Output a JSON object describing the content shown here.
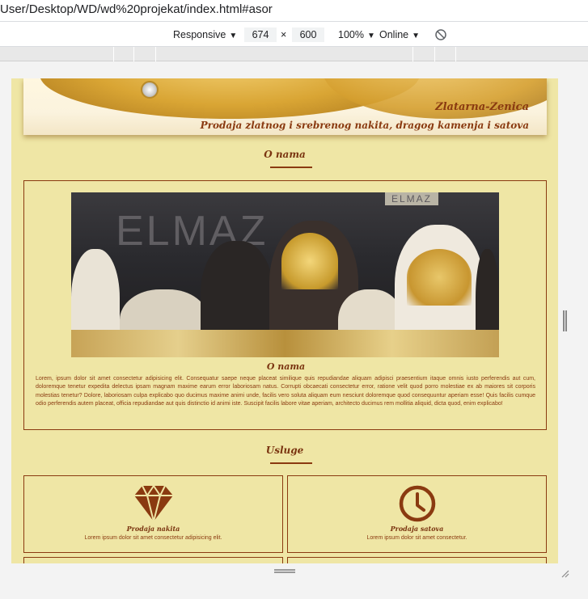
{
  "browser": {
    "url": "User/Desktop/WD/wd%20projekat/index.html#asor"
  },
  "devtools": {
    "device": "Responsive",
    "width": "674",
    "times": "×",
    "height": "600",
    "zoom": "100%",
    "throttle": "Online"
  },
  "hero": {
    "brand": "Zlatarna-Zenica",
    "tagline": "Prodaja zlatnog i srebrenog nakita, dragog kamenja i satova"
  },
  "about": {
    "heading": "O nama",
    "subheading": "O nama",
    "text": "Lorem, ipsum dolor sit amet consectetur adipisicing elit. Consequatur saepe neque placeat similique quis repudiandae aliquam adipisci praesentium itaque omnis iusto perferendis aut cum, doloremque tenetur expedita delectus ipsam magnam maxime earum error laboriosam natus. Corrupti obcaecati consectetur error, ratione velit quod porro molestiae ex ab maiores sit corporis molestias tenetur? Dolore, laboriosam culpa explicabo quo ducimus maxime animi unde, facilis vero soluta aliquam eum nesciunt doloremque quod consequuntur aperiam esse! Quis facilis cumque odio perferendis autem placeat, officia repudiandae aut quis distinctio id animi iste. Suscipit facilis labore vitae aperiam, architecto ducimus rem mollitia aliquid, dicta quod, enim explicabo!",
    "photo_sign": "ELMAZ",
    "photo_sign_small": "ELMAZ"
  },
  "services": {
    "heading": "Usluge",
    "cards": [
      {
        "title": "Prodaja nakita",
        "text": "Lorem ipsum dolor sit amet consectetur adipisicing elit.",
        "icon": "diamond-icon"
      },
      {
        "title": "Prodaja satova",
        "text": "Lorem ipsum dolor sit amet consectetur.",
        "icon": "clock-icon"
      }
    ]
  },
  "colors": {
    "page_bg": "#efe6a5",
    "accent": "#8a3a10"
  }
}
